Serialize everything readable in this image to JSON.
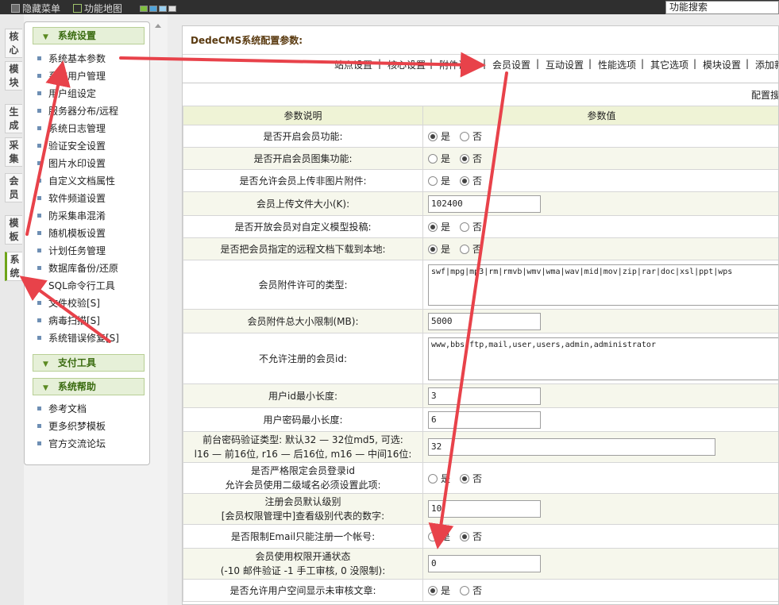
{
  "topbar": {
    "hide_menu": "隐藏菜单",
    "function_map": "功能地图",
    "search_value": "功能搜索",
    "swatches": [
      "#7fbf3f",
      "#4fa3d9",
      "#9ad0f0",
      "#e0e0e0"
    ]
  },
  "vtabs": [
    "核心",
    "模块",
    "生成",
    "采集",
    "会员",
    "模板",
    "系统"
  ],
  "menu": {
    "sections": [
      {
        "title": "系统设置",
        "items": [
          "系统基本参数",
          "系统用户管理",
          "用户组设定",
          "服务器分布/远程",
          "系统日志管理",
          "验证安全设置",
          "图片水印设置",
          "自定义文档属性",
          "软件频道设置",
          "防采集串混淆",
          "随机模板设置",
          "计划任务管理",
          "数据库备份/还原",
          "SQL命令行工具",
          "文件校验[S]",
          "病毒扫描[S]",
          "系统错误修复[S]"
        ]
      },
      {
        "title": "支付工具",
        "items": []
      },
      {
        "title": "系统帮助",
        "items": [
          "参考文档",
          "更多织梦模板",
          "官方交流论坛"
        ]
      }
    ]
  },
  "config": {
    "title": "DedeCMS系统配置参数:",
    "tabs": [
      "站点设置",
      "核心设置",
      "附件设置",
      "会员设置",
      "互动设置",
      "性能选项",
      "其它选项",
      "模块设置",
      "添加新"
    ],
    "search_label": "配置搜",
    "col_label": "参数说明",
    "col_value": "参数值",
    "yes": "是",
    "no": "否",
    "rows": [
      {
        "label": "是否开启会员功能:",
        "type": "radio",
        "value": "是"
      },
      {
        "label": "是否开启会员图集功能:",
        "type": "radio",
        "value": "否"
      },
      {
        "label": "是否允许会员上传非图片附件:",
        "type": "radio",
        "value": "否"
      },
      {
        "label": "会员上传文件大小(K):",
        "type": "text",
        "value": "102400"
      },
      {
        "label": "是否开放会员对自定义模型投稿:",
        "type": "radio",
        "value": "是"
      },
      {
        "label": "是否把会员指定的远程文档下载到本地:",
        "type": "radio",
        "value": "是"
      },
      {
        "label": "会员附件许可的类型:",
        "type": "textarea",
        "value": "swf|mpg|mp3|rm|rmvb|wmv|wma|wav|mid|mov|zip|rar|doc|xsl|ppt|wps"
      },
      {
        "label": "会员附件总大小限制(MB):",
        "type": "text",
        "value": "5000"
      },
      {
        "label": "不允许注册的会员id:",
        "type": "textarea",
        "value": "www,bbs,ftp,mail,user,users,admin,administrator"
      },
      {
        "label": "用户id最小长度:",
        "type": "text",
        "value": "3"
      },
      {
        "label": "用户密码最小长度:",
        "type": "text",
        "value": "6"
      },
      {
        "label": "前台密码验证类型: 默认32 — 32位md5, 可选:",
        "label2": "l16 — 前16位, r16 — 后16位, m16 — 中间16位:",
        "type": "textwide",
        "value": "32"
      },
      {
        "label": "是否严格限定会员登录id",
        "label2": "允许会员使用二级域名必须设置此项:",
        "type": "radio",
        "value": "否"
      },
      {
        "label": "注册会员默认级别",
        "label2": "[会员权限管理中]查看级别代表的数字:",
        "type": "text",
        "value": "10"
      },
      {
        "label": "是否限制Email只能注册一个帐号:",
        "type": "radio",
        "value": "否"
      },
      {
        "label": "会员使用权限开通状态",
        "label2": "(-10 邮件验证 -1 手工审核, 0 没限制):",
        "type": "text",
        "value": "0"
      },
      {
        "label": "是否允许用户空间显示未审核文章:",
        "type": "radio",
        "value": "是"
      }
    ]
  },
  "colors": {
    "accent": "#6fa51a",
    "arrow": "#e8424a",
    "header_bg": "#eff3d6"
  }
}
